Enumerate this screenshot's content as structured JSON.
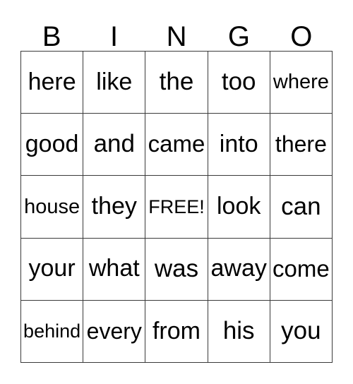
{
  "card": {
    "title": "BINGO",
    "header_letters": [
      "B",
      "I",
      "N",
      "G",
      "O"
    ],
    "colors": {
      "background": "#ffffff",
      "grid_line": "#3a3a3a",
      "text": "#000000"
    },
    "grid": {
      "columns": 5,
      "rows": 5,
      "free_space": "FREE!",
      "cells": [
        [
          "here",
          "like",
          "the",
          "too",
          "where"
        ],
        [
          "good",
          "and",
          "came",
          "into",
          "there"
        ],
        [
          "house",
          "they",
          "FREE!",
          "look",
          "can"
        ],
        [
          "your",
          "what",
          "was",
          "away",
          "come"
        ],
        [
          "behind",
          "every",
          "from",
          "his",
          "you"
        ]
      ]
    }
  }
}
